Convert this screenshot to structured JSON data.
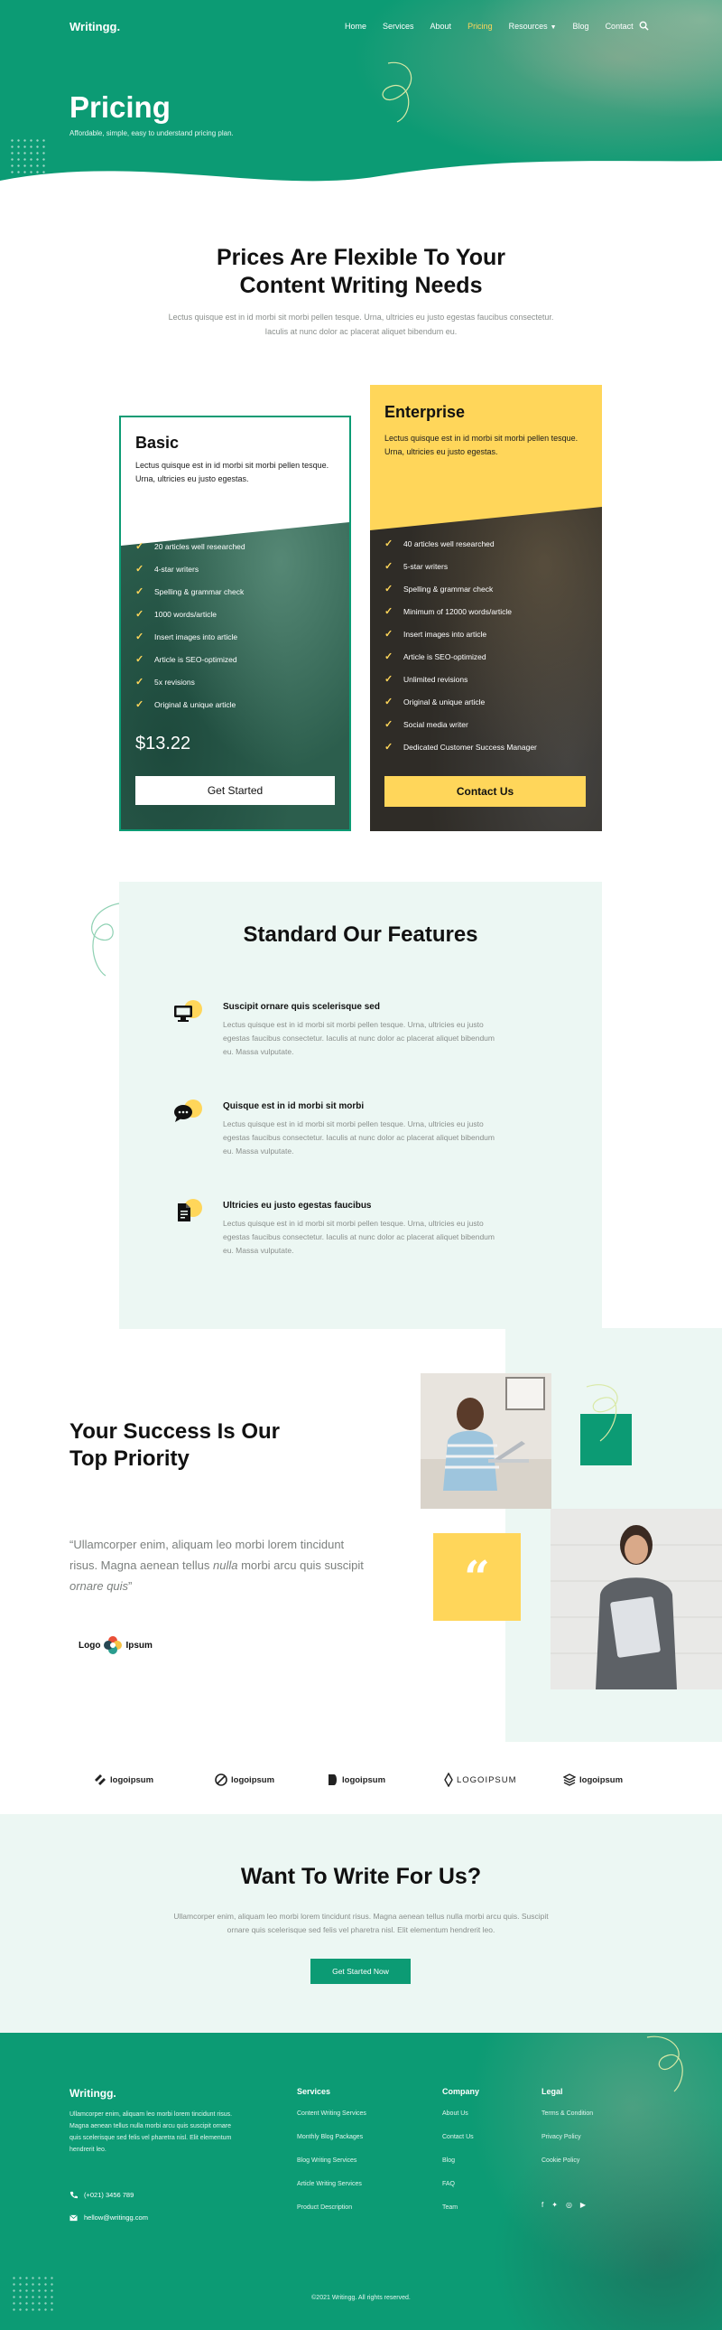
{
  "header": {
    "logo": "Writingg.",
    "nav": [
      {
        "label": "Home",
        "active": false
      },
      {
        "label": "Services",
        "active": false
      },
      {
        "label": "About",
        "active": false
      },
      {
        "label": "Pricing",
        "active": true
      },
      {
        "label": "Resources",
        "active": false,
        "dropdown": true
      },
      {
        "label": "Blog",
        "active": false
      },
      {
        "label": "Contact",
        "active": false
      }
    ],
    "search_icon": "search-icon"
  },
  "hero": {
    "title": "Pricing",
    "subtitle": "Affordable, simple, easy to understand pricing plan."
  },
  "intro": {
    "title_line1": "Prices Are Flexible To Your",
    "title_line2": "Content Writing Needs",
    "text": "Lectus quisque est in id morbi sit morbi pellen tesque. Urna, ultricies eu justo egestas faucibus consectetur. Iaculis at nunc dolor ac placerat aliquet bibendum eu."
  },
  "plans": {
    "basic": {
      "name": "Basic",
      "description": "Lectus quisque est in id morbi sit morbi pellen tesque. Urna, ultricies eu justo egestas.",
      "features": [
        "20 articles well researched",
        "4-star writers",
        "Spelling & grammar check",
        "1000 words/article",
        "Insert images into article",
        "Article is SEO-optimized",
        "5x revisions",
        "Original & unique article"
      ],
      "price": "$13.22",
      "button": "Get Started"
    },
    "enterprise": {
      "name": "Enterprise",
      "description": "Lectus quisque est in id morbi sit morbi pellen tesque. Urna, ultricies eu justo egestas.",
      "features": [
        "40 articles well researched",
        "5-star writers",
        "Spelling & grammar check",
        "Minimum of 12000 words/article",
        "Insert images into article",
        "Article is SEO-optimized",
        "Unlimited revisions",
        "Original & unique article",
        "Social media writer",
        "Dedicated Customer Success Manager"
      ],
      "button": "Contact Us"
    }
  },
  "features": {
    "title": "Standard Our Features",
    "items": [
      {
        "icon": "monitor-icon",
        "title": "Suscipit ornare quis scelerisque sed",
        "text": "Lectus quisque est in id morbi sit morbi pellen tesque. Urna, ultricies eu justo egestas faucibus consectetur. Iaculis at nunc dolor ac placerat aliquet bibendum eu. Massa vulputate."
      },
      {
        "icon": "chat-icon",
        "title": "Quisque est in id morbi sit morbi",
        "text": "Lectus quisque est in id morbi sit morbi pellen tesque. Urna, ultricies eu justo egestas faucibus consectetur. Iaculis at nunc dolor ac placerat aliquet bibendum eu. Massa vulputate."
      },
      {
        "icon": "document-icon",
        "title": "Ultricies eu justo egestas faucibus",
        "text": "Lectus quisque est in id morbi sit morbi pellen tesque. Urna, ultricies eu justo egestas faucibus consectetur. Iaculis at nunc dolor ac placerat aliquet bibendum eu. Massa vulputate."
      }
    ]
  },
  "success": {
    "title_line1": "Your Success Is Our",
    "title_line2": "Top Priority",
    "quote_part1": "“Ullamcorper enim, aliquam leo morbi lorem tincidunt risus. Magna aenean tellus ",
    "quote_em": "nulla",
    "quote_part2": " morbi arcu quis suscipit ",
    "quote_em2": "ornare quis",
    "quote_end": "”",
    "logo_left": "Logo",
    "logo_right": "Ipsum",
    "quote_mark": "“"
  },
  "client_logos": [
    "logoipsum",
    "logoipsum",
    "logoipsum",
    "LOGOIPSUM",
    "logoipsum"
  ],
  "cta": {
    "title": "Want To Write For Us?",
    "text": "Ullamcorper enim, aliquam leo morbi lorem tincidunt risus. Magna aenean tellus nulla morbi arcu quis. Suscipit ornare quis scelerisque sed felis vel pharetra nisl. Elit elementum hendrerit leo.",
    "button": "Get Started Now"
  },
  "footer": {
    "logo": "Writingg.",
    "about": "Ullamcorper enim, aliquam leo morbi lorem tincidunt risus. Magna aenean tellus nulla morbi arcu quis suscipit ornare quis scelerisque sed felis vel pharetra nisl. Elit elementum hendrerit leo.",
    "phone": "(+021) 3456 789",
    "email": "hellow@writingg.com",
    "columns": [
      {
        "heading": "Services",
        "links": [
          "Content Writing Services",
          "Monthly Blog Packages",
          "Blog Writing Services",
          "Article Writing Services",
          "Product Description"
        ]
      },
      {
        "heading": "Company",
        "links": [
          "About Us",
          "Contact Us",
          "Blog",
          "FAQ",
          "Team"
        ]
      },
      {
        "heading": "Legal",
        "links": [
          "Terms & Condition",
          "Privacy Policy",
          "Cookie Policy"
        ]
      }
    ],
    "social": [
      "facebook-icon",
      "twitter-icon",
      "instagram-icon",
      "youtube-icon"
    ],
    "copyright": "©2021 Writingg. All rights reserved."
  },
  "colors": {
    "primary": "#0c9b74",
    "accent": "#ffd65a",
    "light": "#ecf7f3"
  }
}
